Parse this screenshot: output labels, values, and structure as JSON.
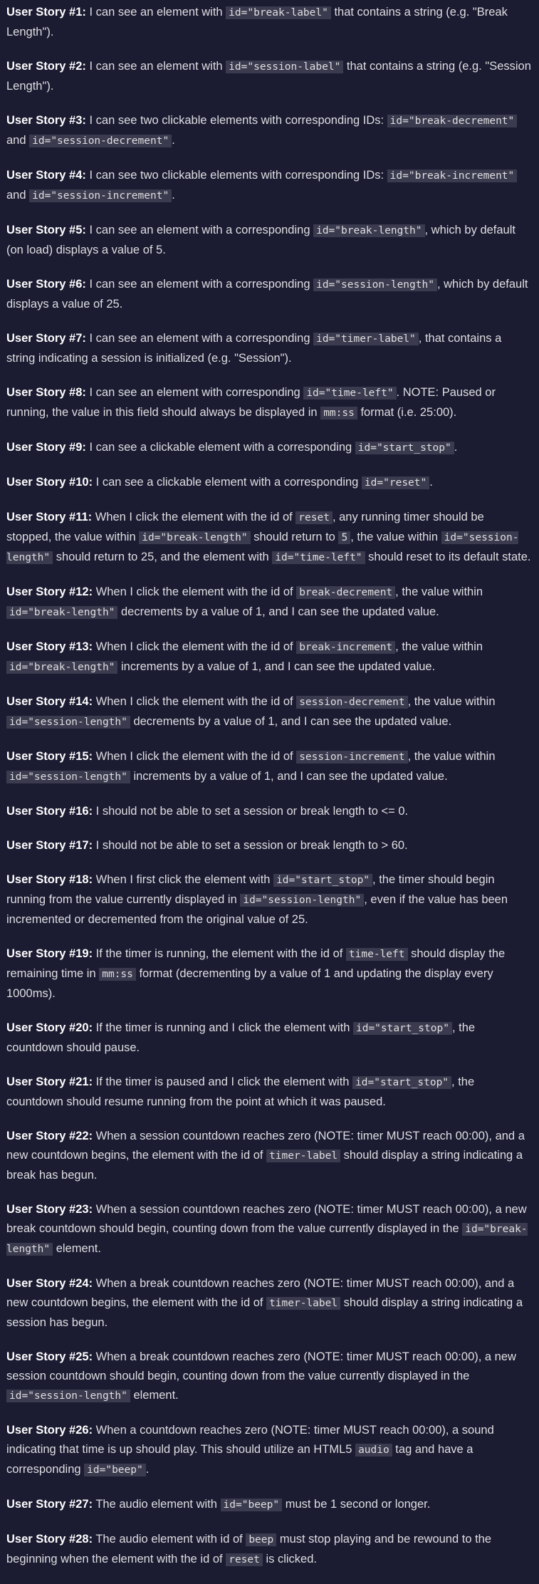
{
  "stories": [
    {
      "label": "User Story #1:",
      "parts": [
        {
          "t": " I can see an element with "
        },
        {
          "c": "id=\"break-label\""
        },
        {
          "t": " that contains a string (e.g. \"Break Length\")."
        }
      ]
    },
    {
      "label": "User Story #2:",
      "parts": [
        {
          "t": " I can see an element with "
        },
        {
          "c": "id=\"session-label\""
        },
        {
          "t": " that contains a string (e.g. \"Session Length\")."
        }
      ]
    },
    {
      "label": "User Story #3:",
      "parts": [
        {
          "t": " I can see two clickable elements with corresponding IDs: "
        },
        {
          "c": "id=\"break-decrement\""
        },
        {
          "t": " and "
        },
        {
          "c": "id=\"session-decrement\""
        },
        {
          "t": "."
        }
      ]
    },
    {
      "label": "User Story #4:",
      "parts": [
        {
          "t": " I can see two clickable elements with corresponding IDs: "
        },
        {
          "c": "id=\"break-increment\""
        },
        {
          "t": " and "
        },
        {
          "c": "id=\"session-increment\""
        },
        {
          "t": "."
        }
      ]
    },
    {
      "label": "User Story #5:",
      "parts": [
        {
          "t": " I can see an element with a corresponding "
        },
        {
          "c": "id=\"break-length\""
        },
        {
          "t": ", which by default (on load) displays a value of 5."
        }
      ]
    },
    {
      "label": "User Story #6:",
      "parts": [
        {
          "t": " I can see an element with a corresponding "
        },
        {
          "c": "id=\"session-length\""
        },
        {
          "t": ", which by default displays a value of 25."
        }
      ]
    },
    {
      "label": "User Story #7:",
      "parts": [
        {
          "t": " I can see an element with a corresponding "
        },
        {
          "c": "id=\"timer-label\""
        },
        {
          "t": ", that contains a string indicating a session is initialized (e.g. \"Session\")."
        }
      ]
    },
    {
      "label": "User Story #8:",
      "parts": [
        {
          "t": " I can see an element with corresponding "
        },
        {
          "c": "id=\"time-left\""
        },
        {
          "t": ". NOTE: Paused or running, the value in this field should always be displayed in "
        },
        {
          "c": "mm:ss"
        },
        {
          "t": " format (i.e. 25:00)."
        }
      ]
    },
    {
      "label": "User Story #9:",
      "parts": [
        {
          "t": " I can see a clickable element with a corresponding "
        },
        {
          "c": "id=\"start_stop\""
        },
        {
          "t": "."
        }
      ]
    },
    {
      "label": "User Story #10:",
      "parts": [
        {
          "t": " I can see a clickable element with a corresponding "
        },
        {
          "c": "id=\"reset\""
        },
        {
          "t": "."
        }
      ]
    },
    {
      "label": "User Story #11:",
      "parts": [
        {
          "t": " When I click the element with the id of "
        },
        {
          "c": "reset"
        },
        {
          "t": ", any running timer should be stopped, the value within "
        },
        {
          "c": "id=\"break-length\""
        },
        {
          "t": " should return to "
        },
        {
          "c": "5"
        },
        {
          "t": ", the value within "
        },
        {
          "c": "id=\"session-length\""
        },
        {
          "t": " should return to 25, and the element with "
        },
        {
          "c": "id=\"time-left\""
        },
        {
          "t": " should reset to its default state."
        }
      ]
    },
    {
      "label": "User Story #12:",
      "parts": [
        {
          "t": " When I click the element with the id of "
        },
        {
          "c": "break-decrement"
        },
        {
          "t": ", the value within "
        },
        {
          "c": "id=\"break-length\""
        },
        {
          "t": " decrements by a value of 1, and I can see the updated value."
        }
      ]
    },
    {
      "label": "User Story #13:",
      "parts": [
        {
          "t": " When I click the element with the id of "
        },
        {
          "c": "break-increment"
        },
        {
          "t": ", the value within "
        },
        {
          "c": "id=\"break-length\""
        },
        {
          "t": " increments by a value of 1, and I can see the updated value."
        }
      ]
    },
    {
      "label": "User Story #14:",
      "parts": [
        {
          "t": " When I click the element with the id of "
        },
        {
          "c": "session-decrement"
        },
        {
          "t": ", the value within "
        },
        {
          "c": "id=\"session-length\""
        },
        {
          "t": " decrements by a value of 1, and I can see the updated value."
        }
      ]
    },
    {
      "label": "User Story #15:",
      "parts": [
        {
          "t": " When I click the element with the id of "
        },
        {
          "c": "session-increment"
        },
        {
          "t": ", the value within "
        },
        {
          "c": "id=\"session-length\""
        },
        {
          "t": " increments by a value of 1, and I can see the updated value."
        }
      ]
    },
    {
      "label": "User Story #16:",
      "parts": [
        {
          "t": " I should not be able to set a session or break length to <= 0."
        }
      ]
    },
    {
      "label": "User Story #17:",
      "parts": [
        {
          "t": " I should not be able to set a session or break length to > 60."
        }
      ]
    },
    {
      "label": "User Story #18:",
      "parts": [
        {
          "t": " When I first click the element with "
        },
        {
          "c": "id=\"start_stop\""
        },
        {
          "t": ", the timer should begin running from the value currently displayed in "
        },
        {
          "c": "id=\"session-length\""
        },
        {
          "t": ", even if the value has been incremented or decremented from the original value of 25."
        }
      ]
    },
    {
      "label": "User Story #19:",
      "parts": [
        {
          "t": " If the timer is running, the element with the id of "
        },
        {
          "c": "time-left"
        },
        {
          "t": " should display the remaining time in "
        },
        {
          "c": "mm:ss"
        },
        {
          "t": " format (decrementing by a value of 1 and updating the display every 1000ms)."
        }
      ]
    },
    {
      "label": "User Story #20:",
      "parts": [
        {
          "t": " If the timer is running and I click the element with "
        },
        {
          "c": "id=\"start_stop\""
        },
        {
          "t": ", the countdown should pause."
        }
      ]
    },
    {
      "label": "User Story #21:",
      "parts": [
        {
          "t": " If the timer is paused and I click the element with "
        },
        {
          "c": "id=\"start_stop\""
        },
        {
          "t": ", the countdown should resume running from the point at which it was paused."
        }
      ]
    },
    {
      "label": "User Story #22:",
      "parts": [
        {
          "t": " When a session countdown reaches zero (NOTE: timer MUST reach 00:00), and a new countdown begins, the element with the id of "
        },
        {
          "c": "timer-label"
        },
        {
          "t": " should display a string indicating a break has begun."
        }
      ]
    },
    {
      "label": "User Story #23:",
      "parts": [
        {
          "t": " When a session countdown reaches zero (NOTE: timer MUST reach 00:00), a new break countdown should begin, counting down from the value currently displayed in the "
        },
        {
          "c": "id=\"break-length\""
        },
        {
          "t": " element."
        }
      ]
    },
    {
      "label": "User Story #24:",
      "parts": [
        {
          "t": " When a break countdown reaches zero (NOTE: timer MUST reach 00:00), and a new countdown begins, the element with the id of "
        },
        {
          "c": "timer-label"
        },
        {
          "t": " should display a string indicating a session has begun."
        }
      ]
    },
    {
      "label": "User Story #25:",
      "parts": [
        {
          "t": " When a break countdown reaches zero (NOTE: timer MUST reach 00:00), a new session countdown should begin, counting down from the value currently displayed in the "
        },
        {
          "c": "id=\"session-length\""
        },
        {
          "t": " element."
        }
      ]
    },
    {
      "label": "User Story #26:",
      "parts": [
        {
          "t": " When a countdown reaches zero (NOTE: timer MUST reach 00:00), a sound indicating that time is up should play. This should utilize an HTML5 "
        },
        {
          "c": "audio"
        },
        {
          "t": " tag and have a corresponding "
        },
        {
          "c": "id=\"beep\""
        },
        {
          "t": "."
        }
      ]
    },
    {
      "label": "User Story #27:",
      "parts": [
        {
          "t": " The audio element with "
        },
        {
          "c": "id=\"beep\""
        },
        {
          "t": " must be 1 second or longer."
        }
      ]
    },
    {
      "label": "User Story #28:",
      "parts": [
        {
          "t": " The audio element with id of "
        },
        {
          "c": "beep"
        },
        {
          "t": " must stop playing and be rewound to the beginning when the element with the id of "
        },
        {
          "c": "reset"
        },
        {
          "t": " is clicked."
        }
      ]
    }
  ]
}
